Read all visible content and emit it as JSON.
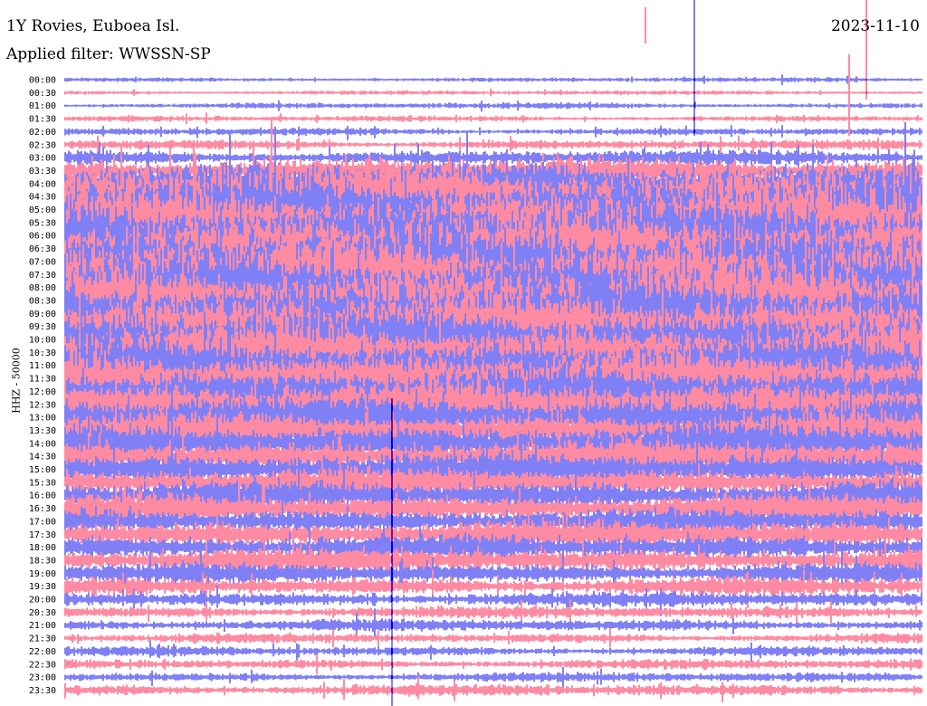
{
  "header": {
    "station": "1Y Rovies, Euboea Isl.",
    "filter": "Applied filter: WWSSN-SP",
    "date": "2023-11-10"
  },
  "chart_data": {
    "type": "line",
    "chart_kind": "helicorder seismogram",
    "ylabel": "HHZ - 50000",
    "colors": [
      "#0000ee",
      "#ff1744"
    ],
    "rows": [
      {
        "label": "00:00",
        "level": 0.15,
        "color": "#0000ee"
      },
      {
        "label": "00:30",
        "level": 0.15,
        "color": "#ff1744"
      },
      {
        "label": "01:00",
        "level": 0.2,
        "color": "#0000ee"
      },
      {
        "label": "01:30",
        "level": 0.2,
        "color": "#ff1744"
      },
      {
        "label": "02:00",
        "level": 0.25,
        "color": "#0000ee"
      },
      {
        "label": "02:30",
        "level": 0.3,
        "color": "#ff1744"
      },
      {
        "label": "03:00",
        "level": 0.4,
        "color": "#0000ee"
      },
      {
        "label": "03:30",
        "level": 0.55,
        "color": "#ff1744"
      },
      {
        "label": "04:00",
        "level": 0.75,
        "color": "#0000ee"
      },
      {
        "label": "04:30",
        "level": 0.95,
        "color": "#ff1744"
      },
      {
        "label": "05:00",
        "level": 1.0,
        "color": "#0000ee"
      },
      {
        "label": "05:30",
        "level": 1.0,
        "color": "#ff1744"
      },
      {
        "label": "06:00",
        "level": 1.0,
        "color": "#0000ee"
      },
      {
        "label": "06:30",
        "level": 1.0,
        "color": "#ff1744"
      },
      {
        "label": "07:00",
        "level": 1.0,
        "color": "#0000ee"
      },
      {
        "label": "07:30",
        "level": 1.0,
        "color": "#ff1744"
      },
      {
        "label": "08:00",
        "level": 1.0,
        "color": "#0000ee"
      },
      {
        "label": "08:30",
        "level": 1.0,
        "color": "#ff1744"
      },
      {
        "label": "09:00",
        "level": 1.0,
        "color": "#0000ee"
      },
      {
        "label": "09:30",
        "level": 0.95,
        "color": "#ff1744"
      },
      {
        "label": "10:00",
        "level": 0.9,
        "color": "#0000ee"
      },
      {
        "label": "10:30",
        "level": 0.9,
        "color": "#ff1744"
      },
      {
        "label": "11:00",
        "level": 0.85,
        "color": "#0000ee"
      },
      {
        "label": "11:30",
        "level": 0.85,
        "color": "#ff1744"
      },
      {
        "label": "12:00",
        "level": 0.8,
        "color": "#0000ee"
      },
      {
        "label": "12:30",
        "level": 0.8,
        "color": "#ff1744"
      },
      {
        "label": "13:00",
        "level": 0.75,
        "color": "#0000ee"
      },
      {
        "label": "13:30",
        "level": 0.7,
        "color": "#ff1744"
      },
      {
        "label": "14:00",
        "level": 0.7,
        "color": "#0000ee"
      },
      {
        "label": "14:30",
        "level": 0.65,
        "color": "#ff1744"
      },
      {
        "label": "15:00",
        "level": 0.65,
        "color": "#0000ee"
      },
      {
        "label": "15:30",
        "level": 0.6,
        "color": "#ff1744"
      },
      {
        "label": "16:00",
        "level": 0.6,
        "color": "#0000ee"
      },
      {
        "label": "16:30",
        "level": 0.6,
        "color": "#ff1744"
      },
      {
        "label": "17:00",
        "level": 0.55,
        "color": "#0000ee"
      },
      {
        "label": "17:30",
        "level": 0.6,
        "color": "#ff1744"
      },
      {
        "label": "18:00",
        "level": 0.55,
        "color": "#0000ee"
      },
      {
        "label": "18:30",
        "level": 0.55,
        "color": "#ff1744"
      },
      {
        "label": "19:00",
        "level": 0.5,
        "color": "#0000ee"
      },
      {
        "label": "19:30",
        "level": 0.45,
        "color": "#ff1744"
      },
      {
        "label": "20:00",
        "level": 0.4,
        "color": "#0000ee"
      },
      {
        "label": "20:30",
        "level": 0.35,
        "color": "#ff1744"
      },
      {
        "label": "21:00",
        "level": 0.35,
        "color": "#0000ee"
      },
      {
        "label": "21:30",
        "level": 0.3,
        "color": "#ff1744"
      },
      {
        "label": "22:00",
        "level": 0.3,
        "color": "#0000ee"
      },
      {
        "label": "22:30",
        "level": 0.3,
        "color": "#ff1744"
      },
      {
        "label": "23:00",
        "level": 0.3,
        "color": "#0000ee"
      },
      {
        "label": "23:30",
        "level": 0.35,
        "color": "#ff1744"
      }
    ]
  }
}
